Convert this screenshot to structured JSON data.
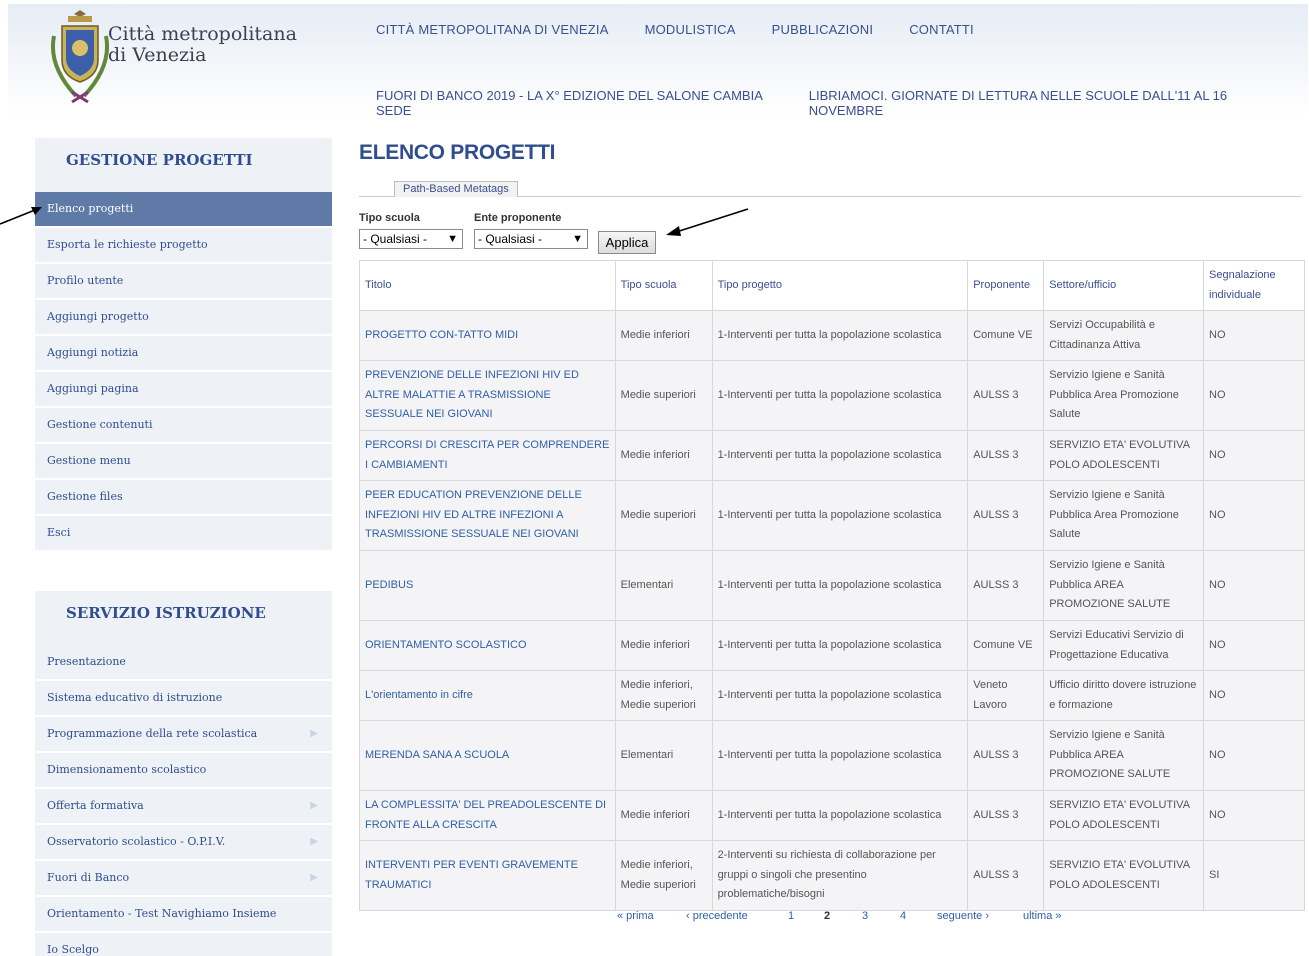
{
  "site": {
    "name_line1": "Città metropolitana",
    "name_line2": "di Venezia"
  },
  "top_nav": [
    "CITTÀ METROPOLITANA DI VENEZIA",
    "MODULISTICA",
    "PUBBLICAZIONI",
    "CONTATTI"
  ],
  "news": [
    "FUORI DI BANCO 2019 - LA X° EDIZIONE DEL SALONE CAMBIA SEDE",
    "LIBRIAMOCI. GIORNATE DI LETTURA NELLE SCUOLE DALL'11 AL 16 NOVEMBRE"
  ],
  "sidebar1": {
    "title": "GESTIONE PROGETTI",
    "items": [
      "Elenco progetti",
      "Esporta le richieste progetto",
      "Profilo utente",
      "Aggiungi progetto",
      "Aggiungi notizia",
      "Aggiungi pagina",
      "Gestione contenuti",
      "Gestione menu",
      "Gestione files",
      "Esci"
    ],
    "active_index": 0
  },
  "sidebar2": {
    "title": "SERVIZIO ISTRUZIONE",
    "items": [
      "Presentazione",
      "Sistema educativo di istruzione",
      "Programmazione della rete scolastica",
      "Dimensionamento scolastico",
      "Offerta formativa",
      "Osservatorio scolastico - O.P.I.V.",
      "Fuori di Banco",
      "Orientamento - Test Navighiamo Insieme",
      "Io Scelgo"
    ],
    "submenu_flags": [
      false,
      false,
      true,
      false,
      true,
      true,
      true,
      false,
      false
    ]
  },
  "main": {
    "title": "ELENCO PROGETTI",
    "tab_label": "Path-Based Metatags",
    "filter_tipo_label": "Tipo scuola",
    "filter_tipo_value": "- Qualsiasi -",
    "filter_ente_label": "Ente proponente",
    "filter_ente_value": "- Qualsiasi -",
    "apply_label": "Applica"
  },
  "table": {
    "headers": [
      "Titolo",
      "Tipo scuola",
      "Tipo progetto",
      "Proponente",
      "Settore/ufficio",
      "Segnalazione individuale"
    ],
    "rows": [
      [
        "PROGETTO CON-TATTO MIDI",
        "Medie inferiori",
        "1-Interventi per tutta la popolazione scolastica",
        "Comune VE",
        "Servizi Occupabilità e Cittadinanza Attiva",
        "NO"
      ],
      [
        "PREVENZIONE DELLE INFEZIONI HIV ED ALTRE MALATTIE A TRASMISSIONE SESSUALE NEI GIOVANI",
        "Medie superiori",
        "1-Interventi per tutta la popolazione scolastica",
        "AULSS 3",
        "Servizio Igiene e Sanità Pubblica Area Promozione Salute",
        "NO"
      ],
      [
        "PERCORSI DI CRESCITA PER COMPRENDERE I CAMBIAMENTI",
        "Medie inferiori",
        "1-Interventi per tutta la popolazione scolastica",
        "AULSS 3",
        "SERVIZIO ETA' EVOLUTIVA POLO ADOLESCENTI",
        "NO"
      ],
      [
        "PEER EDUCATION PREVENZIONE DELLE INFEZIONI HIV ED ALTRE INFEZIONI A TRASMISSIONE SESSUALE NEI GIOVANI",
        "Medie superiori",
        "1-Interventi per tutta la popolazione scolastica",
        "AULSS 3",
        "Servizio Igiene e Sanità Pubblica Area Promozione Salute",
        "NO"
      ],
      [
        "PEDIBUS",
        "Elementari",
        "1-Interventi per tutta la popolazione scolastica",
        "AULSS 3",
        "Servizio Igiene e Sanità Pubblica AREA PROMOZIONE SALUTE",
        "NO"
      ],
      [
        "ORIENTAMENTO SCOLASTICO",
        "Medie inferiori",
        "1-Interventi per tutta la popolazione scolastica",
        "Comune VE",
        "Servizi Educativi Servizio di Progettazione Educativa",
        "NO"
      ],
      [
        "L'orientamento in cifre",
        "Medie inferiori, Medie superiori",
        "1-Interventi per tutta la popolazione scolastica",
        "Veneto Lavoro",
        "Ufficio diritto dovere istruzione e formazione",
        "NO"
      ],
      [
        "MERENDA SANA A SCUOLA",
        "Elementari",
        "1-Interventi per tutta la popolazione scolastica",
        "AULSS 3",
        "Servizio Igiene e Sanità Pubblica AREA PROMOZIONE SALUTE",
        "NO"
      ],
      [
        "LA COMPLESSITA' DEL PREADOLESCENTE DI FRONTE ALLA CRESCITA",
        "Medie inferiori",
        "1-Interventi per tutta la popolazione scolastica",
        "AULSS 3",
        "SERVIZIO ETA' EVOLUTIVA POLO ADOLESCENTI",
        "NO"
      ],
      [
        "INTERVENTI PER EVENTI GRAVEMENTE TRAUMATICI",
        "Medie inferiori, Medie superiori",
        "2-Interventi su richiesta di collaborazione per gruppi o singoli che presentino problematiche/bisogni",
        "AULSS 3",
        "SERVIZIO ETA' EVOLUTIVA POLO ADOLESCENTI",
        "SI"
      ]
    ]
  },
  "pager": {
    "first": "« prima",
    "prev": "‹ precedente",
    "pages": [
      "1",
      "2",
      "3",
      "4"
    ],
    "current": "2",
    "next": "seguente ›",
    "last": "ultima »"
  }
}
